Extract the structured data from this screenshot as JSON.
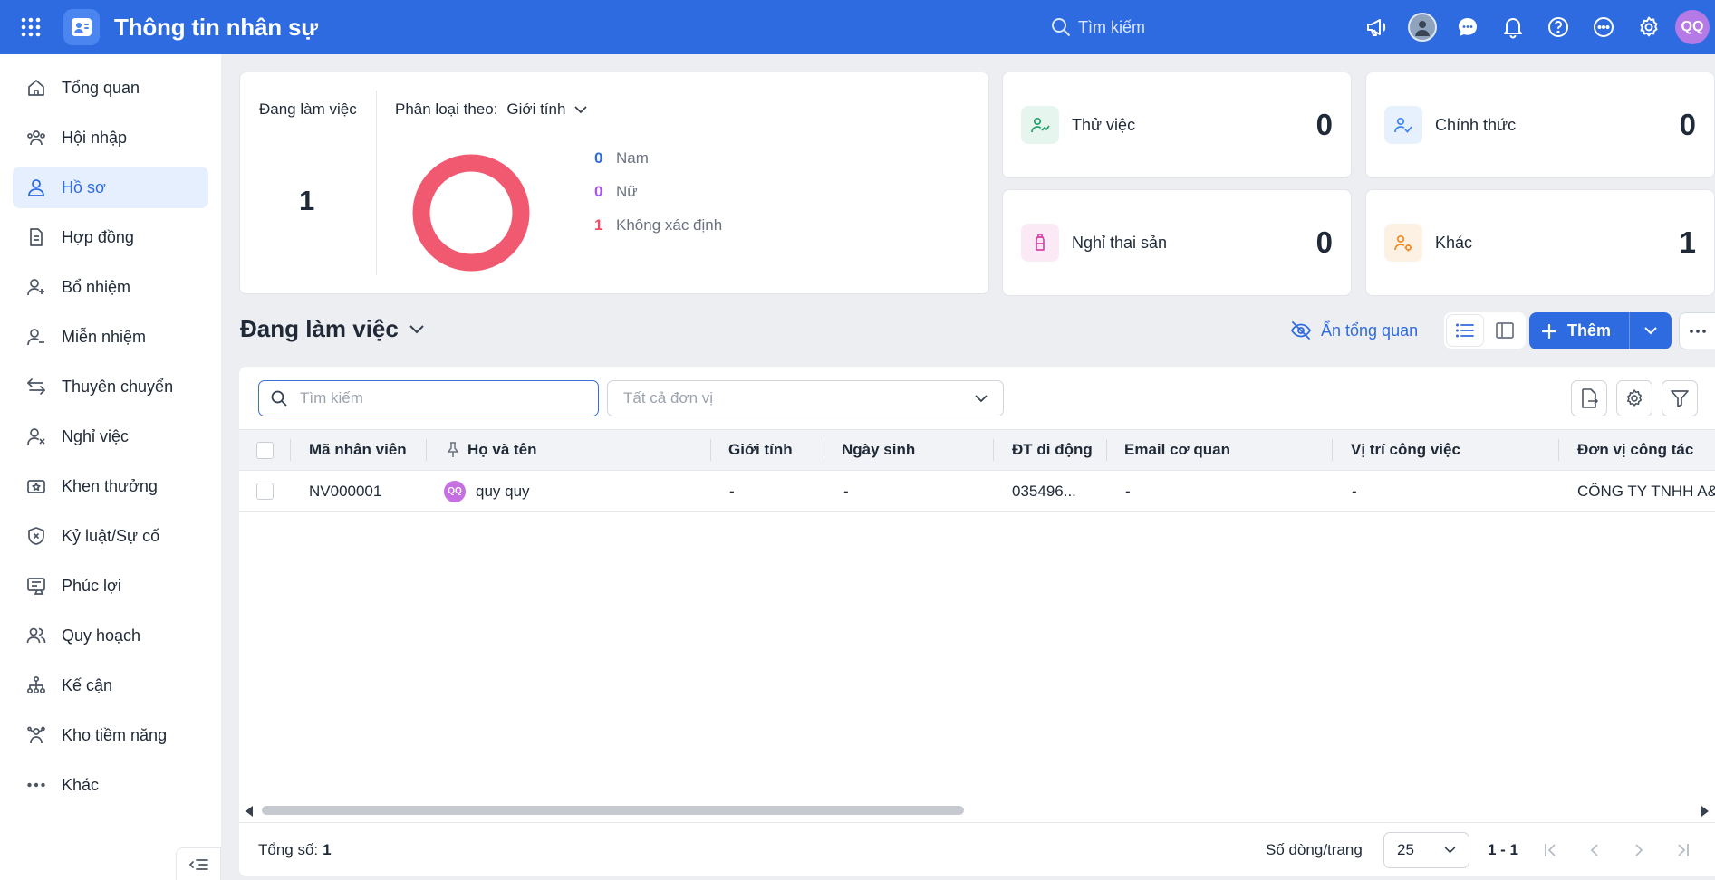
{
  "app": {
    "title": "Thông tin nhân sự",
    "search_placeholder": "Tìm kiếm",
    "user_initials": "QQ"
  },
  "colors": {
    "primary": "#2f6be0",
    "donut": "#f0596f",
    "legend_nam": "#2f6be0",
    "legend_nu": "#a855f7",
    "legend_khac": "#ef4d6a"
  },
  "sidebar": {
    "items": [
      {
        "label": "Tổng quan",
        "icon": "home-icon"
      },
      {
        "label": "Hội nhập",
        "icon": "team-icon"
      },
      {
        "label": "Hồ sơ",
        "icon": "user-icon",
        "active": true
      },
      {
        "label": "Hợp đồng",
        "icon": "document-icon"
      },
      {
        "label": "Bổ nhiệm",
        "icon": "user-plus-icon"
      },
      {
        "label": "Miễn nhiệm",
        "icon": "user-minus-icon"
      },
      {
        "label": "Thuyên chuyển",
        "icon": "transfer-icon"
      },
      {
        "label": "Nghỉ việc",
        "icon": "user-x-icon"
      },
      {
        "label": "Khen thưởng",
        "icon": "reward-icon"
      },
      {
        "label": "Kỷ luật/Sự cố",
        "icon": "shield-x-icon"
      },
      {
        "label": "Phúc lợi",
        "icon": "benefit-icon"
      },
      {
        "label": "Quy hoạch",
        "icon": "users-icon"
      },
      {
        "label": "Kế cận",
        "icon": "hierarchy-icon"
      },
      {
        "label": "Kho tiềm năng",
        "icon": "talent-icon"
      },
      {
        "label": "Khác",
        "icon": "dots-icon"
      }
    ]
  },
  "summary": {
    "working_label": "Đang làm việc",
    "working_count": "1",
    "classify_label": "Phân loại theo:",
    "classify_value": "Giới tính",
    "legend": [
      {
        "count": "0",
        "label": "Nam"
      },
      {
        "count": "0",
        "label": "Nữ"
      },
      {
        "count": "1",
        "label": "Không xác định"
      }
    ]
  },
  "stats": {
    "probation": {
      "label": "Thử việc",
      "value": "0",
      "icon": "user-trend-icon"
    },
    "official": {
      "label": "Chính thức",
      "value": "0",
      "icon": "user-check-icon"
    },
    "maternity": {
      "label": "Nghỉ thai sản",
      "value": "0",
      "icon": "bottle-icon"
    },
    "other": {
      "label": "Khác",
      "value": "1",
      "icon": "user-gear-icon"
    }
  },
  "section": {
    "title": "Đang làm việc",
    "hide_overview": "Ẩn tổng quan",
    "add_label": "Thêm"
  },
  "table": {
    "search_placeholder": "Tìm kiếm",
    "unit_placeholder": "Tất cả đơn vị",
    "columns": [
      "Mã nhân viên",
      "Họ và tên",
      "Giới tính",
      "Ngày sinh",
      "ĐT di động",
      "Email cơ quan",
      "Vị trí công việc",
      "Đơn vị công tác"
    ],
    "rows": [
      {
        "code": "NV000001",
        "avatar": "QQ",
        "name": "quy quy",
        "gender": "-",
        "dob": "-",
        "phone": "035496...",
        "email": "-",
        "position": "-",
        "unit": "CÔNG TY TNHH A&"
      }
    ]
  },
  "footer": {
    "total_label": "Tổng số:",
    "total_value": "1",
    "rows_per_page_label": "Số dòng/trang",
    "rows_per_page": "25",
    "range": "1 - 1"
  }
}
